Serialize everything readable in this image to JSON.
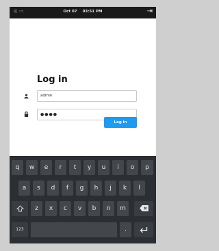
{
  "status_bar": {
    "date": "Oct 07",
    "time": "03:51 PM"
  },
  "login": {
    "title": "Log in",
    "username_value": "admin",
    "password_value": "●●●●",
    "login_button": "Log in"
  },
  "keyboard": {
    "row1": [
      "q",
      "w",
      "e",
      "r",
      "t",
      "y",
      "u",
      "i",
      "o",
      "p"
    ],
    "row2": [
      "a",
      "s",
      "d",
      "f",
      "g",
      "h",
      "j",
      "k",
      "l"
    ],
    "row3": [
      "z",
      "x",
      "c",
      "v",
      "b",
      "n",
      "m"
    ],
    "numbers_key": "123",
    "dot_key": "."
  }
}
